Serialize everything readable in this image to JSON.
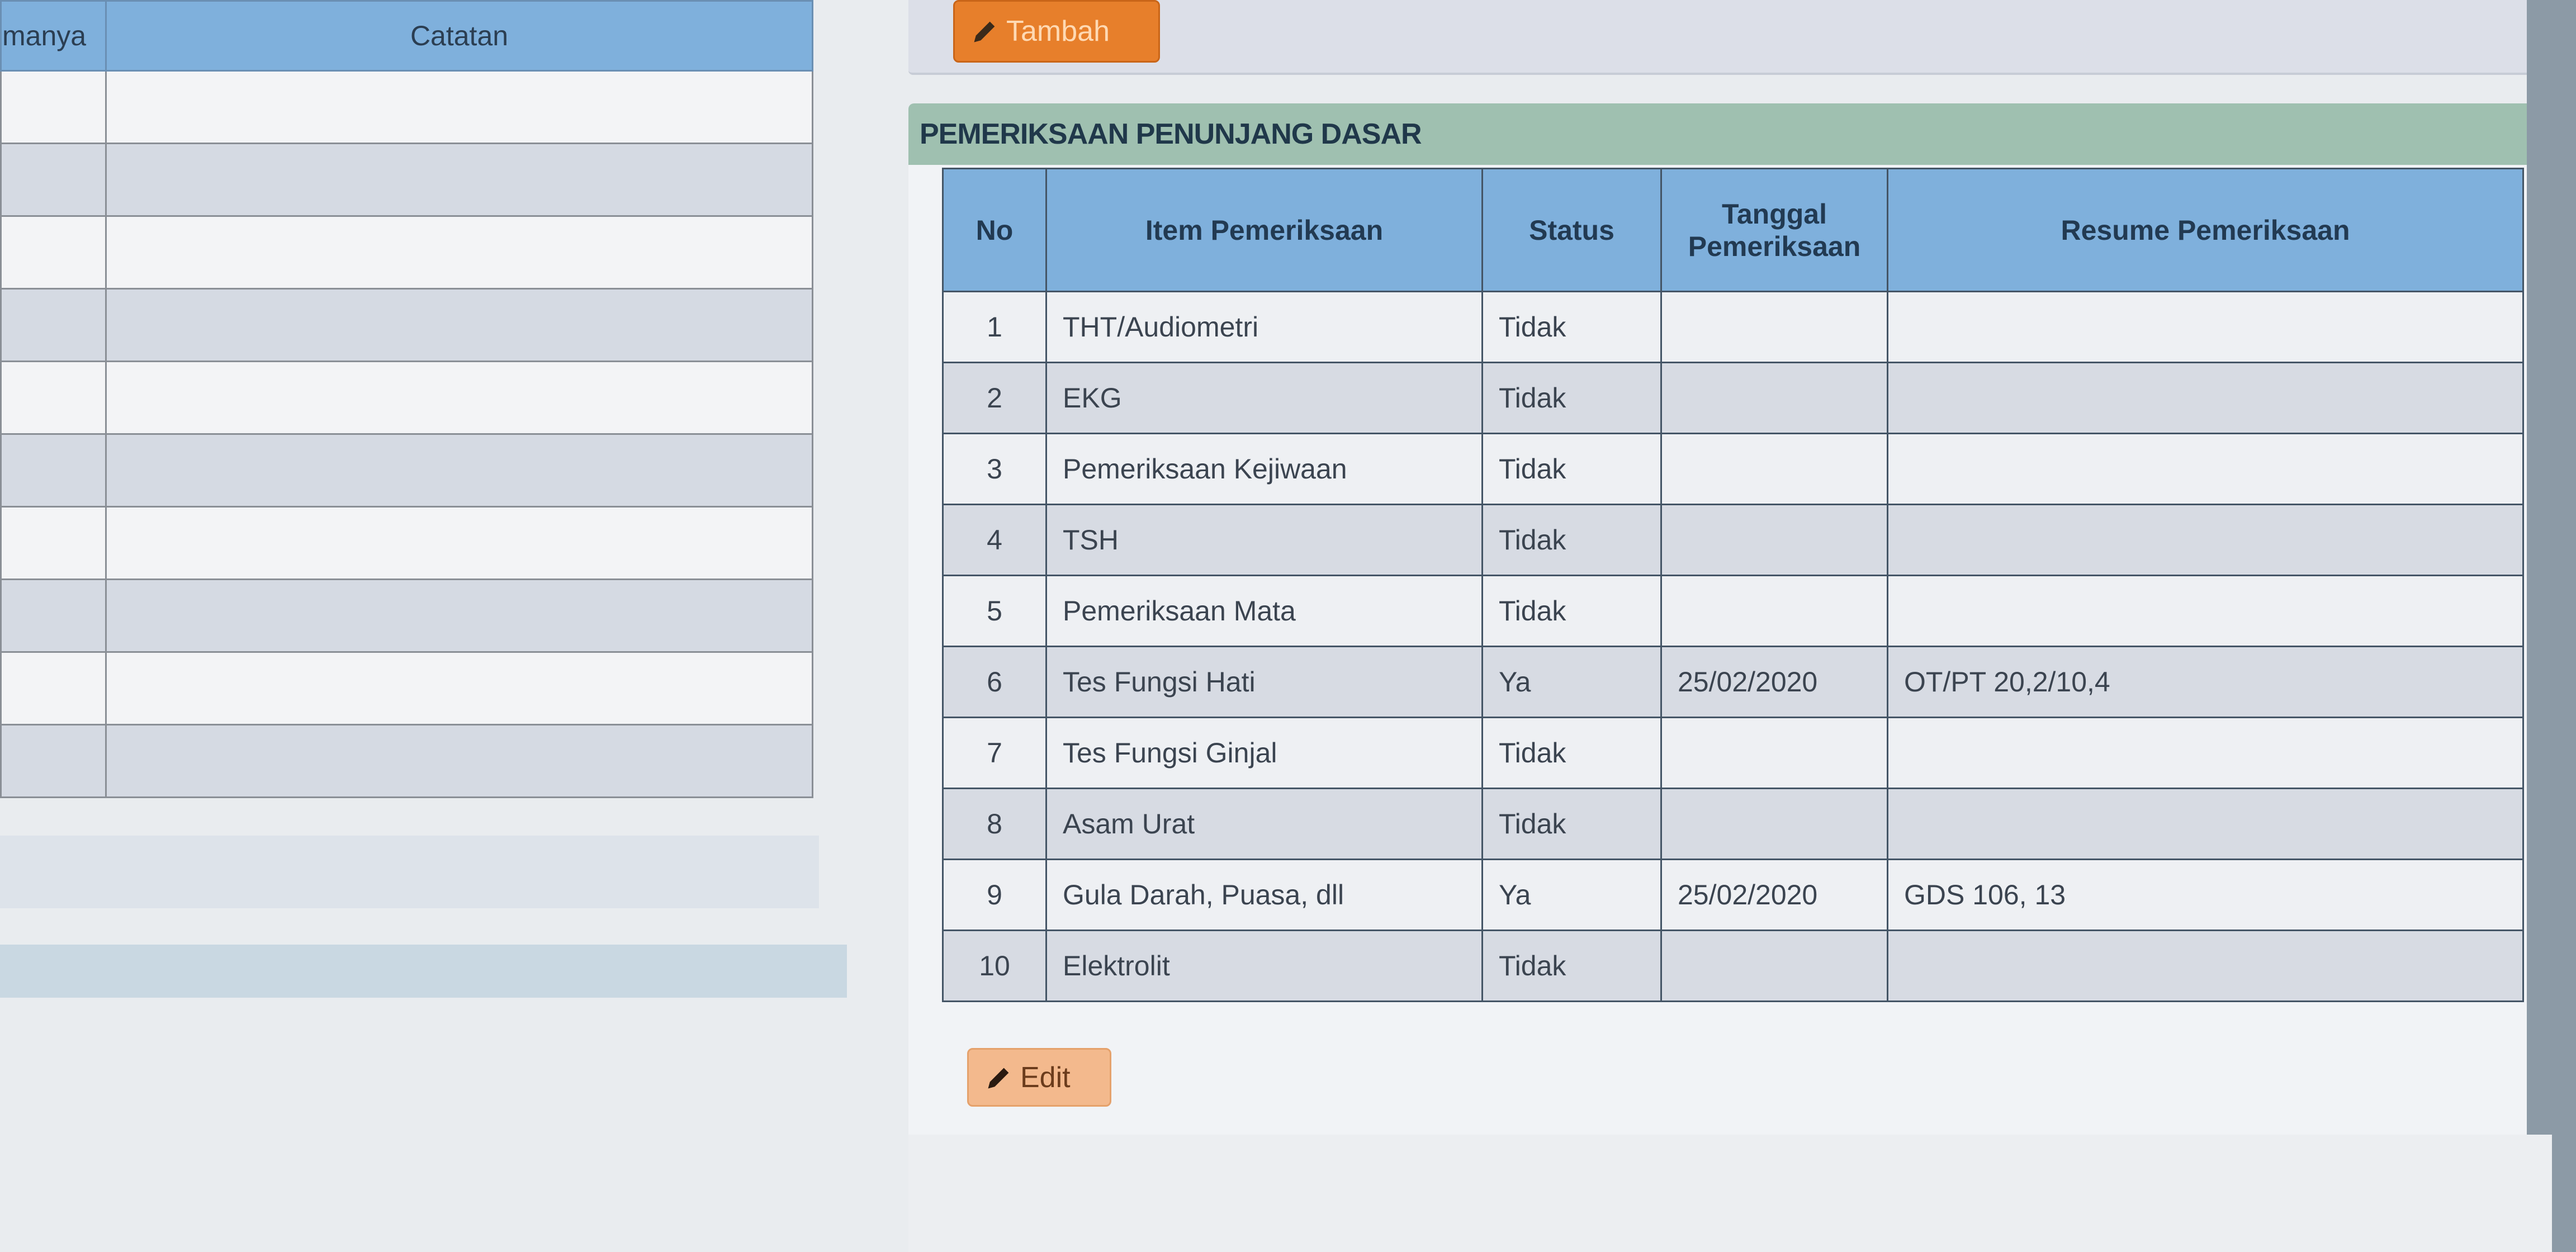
{
  "left_table": {
    "headers": [
      "manya",
      "Catatan"
    ],
    "row_count": 10
  },
  "buttons": {
    "add_label": "Tambah",
    "edit_label": "Edit"
  },
  "section": {
    "title": "PEMERIKSAAN PENUNJANG DASAR"
  },
  "table": {
    "headers": {
      "no": "No",
      "item": "Item Pemeriksaan",
      "status": "Status",
      "date_line1": "Tanggal",
      "date_line2": "Pemeriksaan",
      "resume": "Resume Pemeriksaan"
    },
    "rows": [
      {
        "no": "1",
        "item": "THT/Audiometri",
        "status": "Tidak",
        "date": "",
        "resume": ""
      },
      {
        "no": "2",
        "item": "EKG",
        "status": "Tidak",
        "date": "",
        "resume": ""
      },
      {
        "no": "3",
        "item": "Pemeriksaan Kejiwaan",
        "status": "Tidak",
        "date": "",
        "resume": ""
      },
      {
        "no": "4",
        "item": "TSH",
        "status": "Tidak",
        "date": "",
        "resume": ""
      },
      {
        "no": "5",
        "item": "Pemeriksaan Mata",
        "status": "Tidak",
        "date": "",
        "resume": ""
      },
      {
        "no": "6",
        "item": "Tes Fungsi Hati",
        "status": "Ya",
        "date": "25/02/2020",
        "resume": "OT/PT 20,2/10,4"
      },
      {
        "no": "7",
        "item": "Tes Fungsi Ginjal",
        "status": "Tidak",
        "date": "",
        "resume": ""
      },
      {
        "no": "8",
        "item": "Asam Urat",
        "status": "Tidak",
        "date": "",
        "resume": ""
      },
      {
        "no": "9",
        "item": "Gula Darah, Puasa, dll",
        "status": "Ya",
        "date": "25/02/2020",
        "resume": "GDS 106, 13"
      },
      {
        "no": "10",
        "item": "Elektrolit",
        "status": "Tidak",
        "date": "",
        "resume": ""
      }
    ]
  },
  "colors": {
    "header_blue": "#7fb0dc",
    "add_button": "#e77f2b",
    "edit_button": "#f3b98d",
    "section_header": "#9fc0b0"
  },
  "icons": [
    "pencil-icon"
  ]
}
